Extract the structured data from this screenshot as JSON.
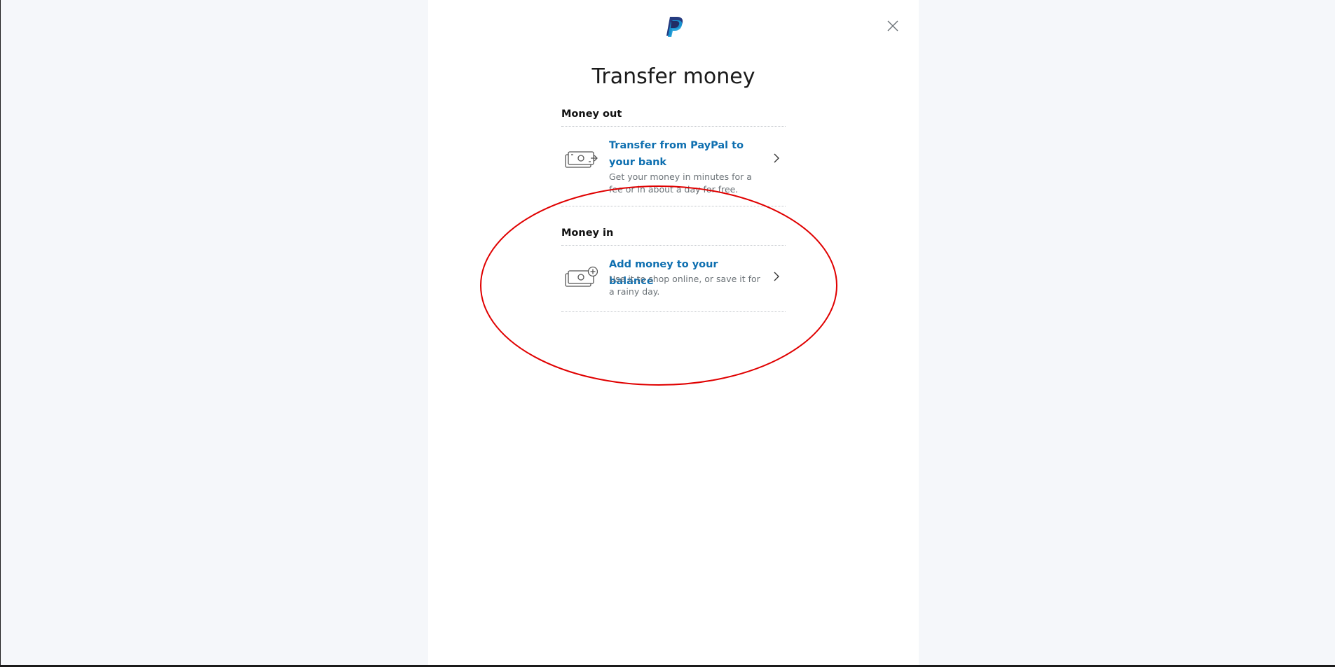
{
  "dialog": {
    "title": "Transfer money",
    "logo_icon": "paypal-logo-icon",
    "close_icon": "close-icon"
  },
  "sections": [
    {
      "label": "Money out",
      "items": [
        {
          "title": "Transfer from PayPal to your bank",
          "description": "Get your money in minutes for a fee or in about a day for free.",
          "icon": "cash-arrow-out-icon",
          "chevron": "chevron-right-icon"
        }
      ]
    },
    {
      "label": "Money in",
      "items": [
        {
          "title": "Add money to your balance",
          "description": "Use it to shop online, or save it for a rainy day.",
          "icon": "cash-plus-icon",
          "chevron": "chevron-right-icon"
        }
      ]
    }
  ],
  "colors": {
    "link": "#0e6fb0",
    "annotation": "#e00000",
    "background": "#f5f7fa",
    "paypal_dark": "#253b80",
    "paypal_light": "#179bd7"
  }
}
